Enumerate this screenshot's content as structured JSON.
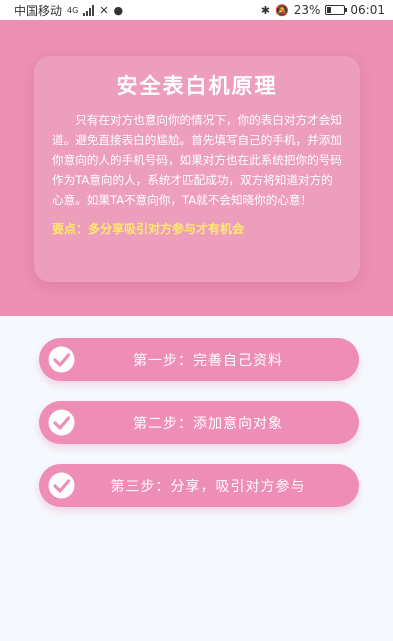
{
  "status_bar": {
    "carrier": "中国移动",
    "network": "4G",
    "battery_percent": "23%",
    "time": "06:01",
    "battery_level": 0.23,
    "icons": [
      "signal-icon",
      "notification-icon",
      "message-icon",
      "bluetooth-icon",
      "mute-icon",
      "battery-icon"
    ]
  },
  "card": {
    "title": "安全表白机原理",
    "body": "只有在对方也意向你的情况下，你的表白对方才会知道。避免直接表白的尴尬。首先填写自己的手机，并添加你意向的人的手机号码，如果对方也在此系统把你的号码作为TA意向的人，系统才匹配成功，双方将知道对方的心意。如果TA不意向你，TA就不会知晓你的心意！",
    "highlight": "要点：多分享吸引对方参与才有机会"
  },
  "steps": [
    {
      "label": "第一步：完善自己资料",
      "icon": "check-circle-icon"
    },
    {
      "label": "第二步：添加意向对象",
      "icon": "check-circle-icon"
    },
    {
      "label": "第三步：分享，吸引对方参与",
      "icon": "check-circle-icon"
    }
  ],
  "colors": {
    "hero_background": "#ec8fb3",
    "button_background": "#ee8db5",
    "highlight_text": "#ffe96b",
    "page_background": "#f5f9fd"
  }
}
